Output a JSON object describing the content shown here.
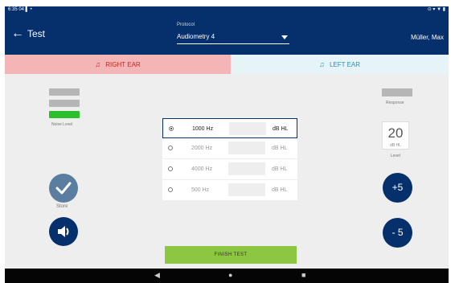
{
  "status": {
    "left": "6:35 04 ▌ •",
    "right": "⊙ ▾ ▼ ▮"
  },
  "app": {
    "title": "Test",
    "back_icon": "arrow-left-icon",
    "user": "Müller, Max"
  },
  "protocol": {
    "label": "Protocol",
    "value": "Audiometry 4"
  },
  "tabs": {
    "right": {
      "label": "RIGHT EAR",
      "icon": "ear-icon",
      "color": "#c62828"
    },
    "left": {
      "label": "LEFT EAR",
      "icon": "ear-icon",
      "color": "#2a8fb3"
    }
  },
  "noise": {
    "label": "Noise Level",
    "status_color": "#2bc02b"
  },
  "response": {
    "label": "Response"
  },
  "level": {
    "value": "20",
    "unit": "dB HL",
    "label": "Level"
  },
  "frequencies": [
    {
      "hz": "1000 Hz",
      "unit": "dB HL",
      "selected": true
    },
    {
      "hz": "2000 Hz",
      "unit": "dB HL",
      "selected": false
    },
    {
      "hz": "4000 Hz",
      "unit": "dB HL",
      "selected": false
    },
    {
      "hz": "500 Hz",
      "unit": "dB HL",
      "selected": false
    }
  ],
  "controls": {
    "plus": "+5",
    "minus": "- 5",
    "store_label": "Store"
  },
  "finish": {
    "label": "FINISH TEST"
  },
  "nav": {
    "back": "◀",
    "home": "●",
    "recent": "■"
  }
}
